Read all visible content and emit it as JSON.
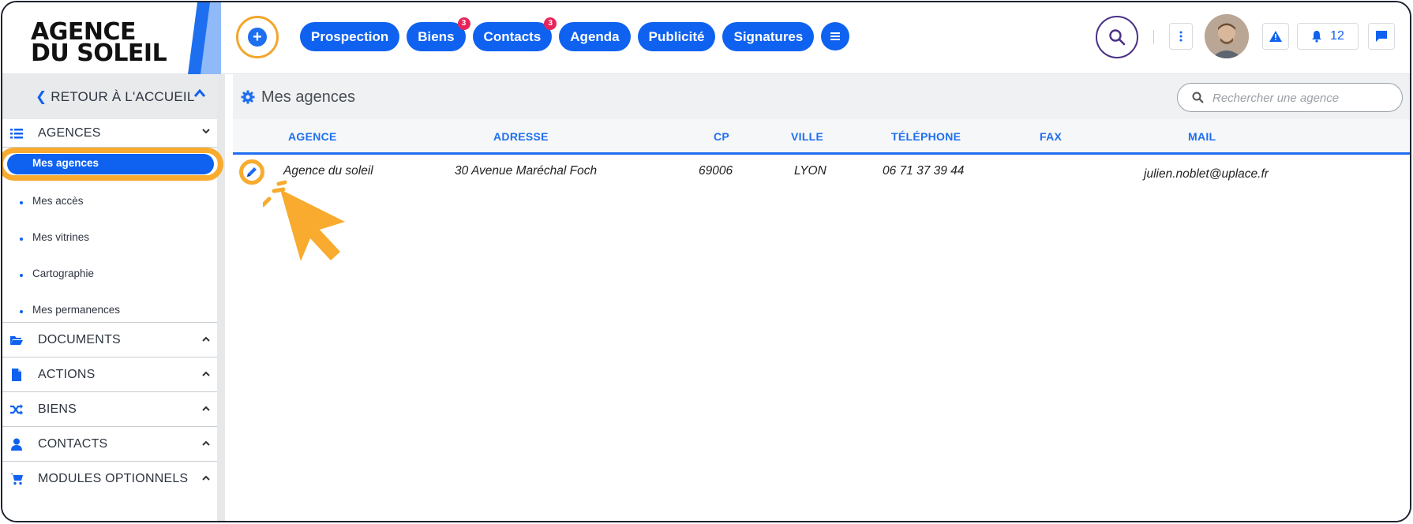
{
  "brand": {
    "line1": "AGENCE",
    "line2": "DU SOLEIL",
    "accent": "#1e6ff0",
    "highlight": "#f8ab2e"
  },
  "topnav": {
    "items": [
      {
        "label": "Prospection"
      },
      {
        "label": "Biens",
        "badge": "3"
      },
      {
        "label": "Contacts",
        "badge": "3"
      },
      {
        "label": "Agenda"
      },
      {
        "label": "Publicité"
      },
      {
        "label": "Signatures"
      }
    ],
    "notifications_count": "12"
  },
  "sidebar": {
    "back_label": "RETOUR À L'ACCUEIL",
    "sections": {
      "agences": "AGENCES",
      "documents": "DOCUMENTS",
      "actions": "ACTIONS",
      "biens": "BIENS",
      "contacts": "CONTACTS",
      "modules": "MODULES OPTIONNELS"
    },
    "items": [
      "Mes agences",
      "Mes accès",
      "Mes vitrines",
      "Cartographie",
      "Mes permanences"
    ]
  },
  "main": {
    "title": "Mes agences",
    "search_placeholder": "Rechercher une agence",
    "columns": {
      "agence": "AGENCE",
      "adresse": "ADRESSE",
      "cp": "CP",
      "ville": "VILLE",
      "telephone": "TÉLÉPHONE",
      "fax": "FAX",
      "mail": "MAIL"
    },
    "rows": [
      {
        "agence": "Agence du soleil",
        "adresse": "30 Avenue Maréchal Foch",
        "cp": "69006",
        "ville": "LYON",
        "telephone": "06 71 37 39 44",
        "fax": "",
        "mail": "julien.noblet@uplace.fr"
      }
    ]
  }
}
